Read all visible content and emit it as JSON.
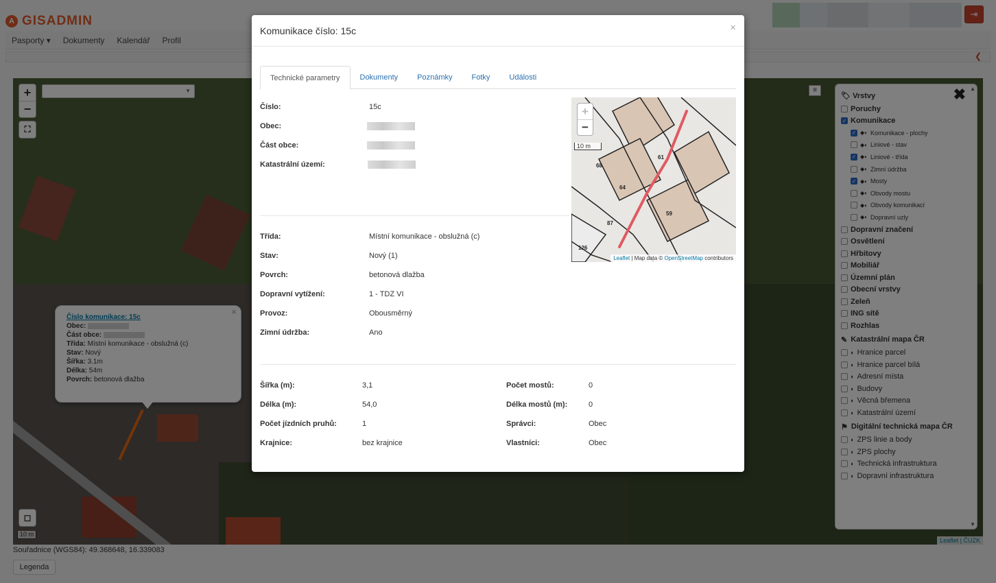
{
  "app": {
    "logo_text": "GISADMIN",
    "logo_initial": "A",
    "logout_icon": "⇥"
  },
  "nav": [
    {
      "label": "Pasporty ▾"
    },
    {
      "label": "Dokumenty"
    },
    {
      "label": "Kalendář"
    },
    {
      "label": "Profil"
    }
  ],
  "map": {
    "zoom_in": "+",
    "zoom_out": "−",
    "fullscreen": "⛶",
    "scale": "10 m",
    "attribution": "Leaflet | ČUZK",
    "layer_button": "≡"
  },
  "popup": {
    "title": "Číslo komunikace: 15c",
    "obec_label": "Obec:",
    "cast_obce_label": "Část obce:",
    "trida_label": "Třída:",
    "trida_value": "Místní komunikace - obslužná (c)",
    "stav_label": "Stav:",
    "stav_value": "Nový",
    "sirka_label": "Šířka:",
    "sirka_value": "3.1m",
    "delka_label": "Délka:",
    "delka_value": "54m",
    "povrch_label": "Povrch:",
    "povrch_value": "betonová dlažba",
    "close": "×"
  },
  "layers": {
    "close": "✖",
    "header": "Vrstvy",
    "items": [
      {
        "label": "Poruchy",
        "checked": false,
        "sub": false
      },
      {
        "label": "Komunikace",
        "checked": true,
        "sub": false
      },
      {
        "label": "Komunikace - plochy",
        "checked": true,
        "sub": true
      },
      {
        "label": "Liniové - stav",
        "checked": false,
        "sub": true
      },
      {
        "label": "Liniové - třída",
        "checked": true,
        "sub": true
      },
      {
        "label": "Zimní údržba",
        "checked": false,
        "sub": true
      },
      {
        "label": "Mosty",
        "checked": true,
        "sub": true
      },
      {
        "label": "Obvody mostu",
        "checked": false,
        "sub": true
      },
      {
        "label": "Obvody komunikací",
        "checked": false,
        "sub": true
      },
      {
        "label": "Dopravní uzly",
        "checked": false,
        "sub": true
      },
      {
        "label": "Dopravní značení",
        "checked": false,
        "sub": false
      },
      {
        "label": "Osvětlení",
        "checked": false,
        "sub": false
      },
      {
        "label": "Hřbitovy",
        "checked": false,
        "sub": false
      },
      {
        "label": "Mobiliář",
        "checked": false,
        "sub": false
      },
      {
        "label": "Územní plán",
        "checked": false,
        "sub": false
      },
      {
        "label": "Obecní vrstvy",
        "checked": false,
        "sub": false
      },
      {
        "label": "Zeleň",
        "checked": false,
        "sub": false
      },
      {
        "label": "ING sítě",
        "checked": false,
        "sub": false
      },
      {
        "label": "Rozhlas",
        "checked": false,
        "sub": false
      }
    ],
    "section_katastr": "Katastrální mapa ČR",
    "katastr_items": [
      {
        "label": "Hranice parcel"
      },
      {
        "label": "Hranice parcel bílá"
      },
      {
        "label": "Adresní místa"
      },
      {
        "label": "Budovy"
      },
      {
        "label": "Věcná břemena"
      },
      {
        "label": "Katastrální území"
      }
    ],
    "section_dtm": "Digitální technická mapa ČR",
    "dtm_items": [
      {
        "label": "ZPS linie a body"
      },
      {
        "label": "ZPS plochy"
      },
      {
        "label": "Technická infrastruktura"
      },
      {
        "label": "Dopravní infrastruktura"
      }
    ]
  },
  "coords": "Souřadnice (WGS84): 49.368648, 16.339083",
  "legend_button": "Legenda",
  "modal": {
    "title": "Komunikace číslo: 15c",
    "close": "×",
    "tabs": [
      "Technické parametry",
      "Dokumenty",
      "Poznámky",
      "Fotky",
      "Události"
    ],
    "cislo_label": "Číslo:",
    "cislo_value": "15c",
    "obec_label": "Obec:",
    "cast_obce_label": "Část obce:",
    "ku_label": "Katastrální území:",
    "trida_label": "Třída:",
    "trida_value": "Místní komunikace - obslužná (c)",
    "stav_label": "Stav:",
    "stav_value": "Nový (1)",
    "povrch_label": "Povrch:",
    "povrch_value": "betonová dlažba",
    "zatizeni_label": "Dopravní vytížení:",
    "zatizeni_value": "1 - TDZ VI",
    "provoz_label": "Provoz:",
    "provoz_value": "Obousměrný",
    "zimni_label": "Zimní údržba:",
    "zimni_value": "Ano",
    "sirka_label": "Šířka (m):",
    "sirka_value": "3,1",
    "delka_label": "Délka (m):",
    "delka_value": "54,0",
    "pruhy_label": "Počet jízdních pruhů:",
    "pruhy_value": "1",
    "krajnice_label": "Krajnice:",
    "krajnice_value": "bez krajnice",
    "mosty_label": "Počet mostů:",
    "mosty_value": "0",
    "delka_mostu_label": "Délka mostů (m):",
    "delka_mostu_value": "0",
    "spravci_label": "Správci:",
    "spravci_value": "Obec",
    "vlastnici_label": "Vlastníci:",
    "vlastnici_value": "Obec",
    "minimap": {
      "zoom_in": "+",
      "zoom_out": "−",
      "scale": "10 m",
      "attr_leaflet": "Leaflet",
      "attr_mid": " | Map data © ",
      "attr_osm": "OpenStreetMap",
      "attr_end": " contributors",
      "parcels": [
        "68",
        "64",
        "59",
        "126",
        "87",
        "61"
      ]
    }
  }
}
